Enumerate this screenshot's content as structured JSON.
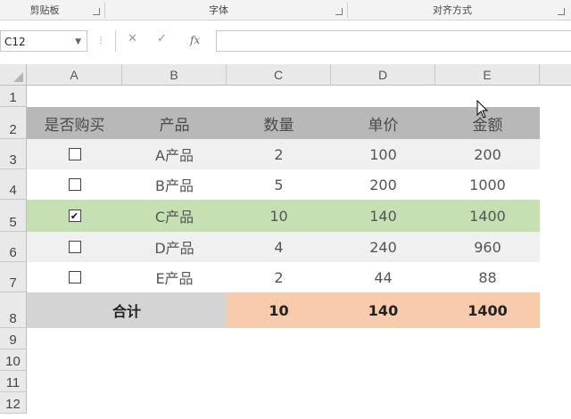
{
  "ribbon": {
    "groups": [
      "剪贴板",
      "字体",
      "对齐方式"
    ]
  },
  "formula_bar": {
    "name_box": "C12",
    "cancel_icon": "✕",
    "enter_icon": "✓",
    "fx_label": "fx",
    "formula": ""
  },
  "columns": [
    "A",
    "B",
    "C",
    "D",
    "E"
  ],
  "rows": [
    "1",
    "2",
    "3",
    "4",
    "5",
    "6",
    "7",
    "8",
    "9",
    "10",
    "11",
    "12"
  ],
  "table": {
    "headers": [
      "是否购买",
      "产品",
      "数量",
      "单价",
      "金额"
    ],
    "rows": [
      {
        "checked": false,
        "product": "A产品",
        "qty": "2",
        "price": "100",
        "amount": "200"
      },
      {
        "checked": false,
        "product": "B产品",
        "qty": "5",
        "price": "200",
        "amount": "1000"
      },
      {
        "checked": true,
        "product": "C产品",
        "qty": "10",
        "price": "140",
        "amount": "1400"
      },
      {
        "checked": false,
        "product": "D产品",
        "qty": "4",
        "price": "240",
        "amount": "960"
      },
      {
        "checked": false,
        "product": "E产品",
        "qty": "2",
        "price": "44",
        "amount": "88"
      }
    ],
    "total": {
      "label": "合计",
      "qty": "10",
      "price": "140",
      "amount": "1400"
    }
  },
  "colors": {
    "header_band": "#b8b8b8",
    "stripe_band": "#f0f0f0",
    "selected_band": "#c6e0b4",
    "total_label_band": "#d4d4d4",
    "total_value_band": "#f8cbad"
  },
  "icons": {
    "checkbox_checked": "✔"
  }
}
